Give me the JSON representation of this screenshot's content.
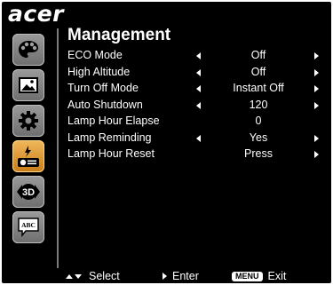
{
  "logo": "acer",
  "title": "Management",
  "sidebar": {
    "items": [
      {
        "icon": "palette-icon"
      },
      {
        "icon": "image-icon"
      },
      {
        "icon": "gear-icon"
      },
      {
        "icon": "management-icon",
        "active": true
      },
      {
        "icon": "3d-icon"
      },
      {
        "icon": "language-icon"
      }
    ]
  },
  "menu": {
    "rows": [
      {
        "label": "ECO Mode",
        "value": "Off",
        "left_arrow": true,
        "right_arrow": true
      },
      {
        "label": "High Altitude",
        "value": "Off",
        "left_arrow": true,
        "right_arrow": true
      },
      {
        "label": "Turn Off Mode",
        "value": "Instant Off",
        "left_arrow": true,
        "right_arrow": true
      },
      {
        "label": "Auto Shutdown",
        "value": "120",
        "left_arrow": true,
        "right_arrow": true
      },
      {
        "label": "Lamp Hour Elapse",
        "value": "0",
        "left_arrow": false,
        "right_arrow": false
      },
      {
        "label": "Lamp Reminding",
        "value": "Yes",
        "left_arrow": true,
        "right_arrow": true
      },
      {
        "label": "Lamp Hour Reset",
        "value": "Press",
        "left_arrow": false,
        "right_arrow": true
      }
    ]
  },
  "footer": {
    "select_label": "Select",
    "enter_label": "Enter",
    "menu_key": "MENU",
    "exit_label": "Exit"
  },
  "icons": {
    "3d_text": "3D",
    "abc_text": "ABC"
  },
  "colors": {
    "background": "#000000",
    "active_accent": "#e8a03a",
    "text": "#ffffff"
  }
}
